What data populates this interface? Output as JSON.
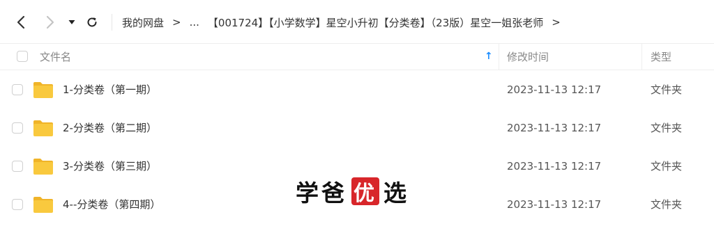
{
  "toolbar": {
    "back_icon": "chevron-left-icon",
    "forward_icon": "chevron-right-icon",
    "dropdown_icon": "caret-down-icon",
    "refresh_icon": "refresh-icon"
  },
  "breadcrumb": {
    "root": "我的网盘",
    "sep1": ">",
    "ellipsis": "...",
    "current": "【001724】【小学数学】星空小升初【分类卷】（23版）星空一姐张老师",
    "sep2": ">"
  },
  "columns": {
    "name": "文件名",
    "sort_indicator": "↑",
    "modified": "修改时间",
    "type": "类型"
  },
  "rows": [
    {
      "name": "1-分类卷（第一期）",
      "modified": "2023-11-13 12:17",
      "type": "文件夹"
    },
    {
      "name": "2-分类卷（第二期）",
      "modified": "2023-11-13 12:17",
      "type": "文件夹"
    },
    {
      "name": "3-分类卷（第三期）",
      "modified": "2023-11-13 12:17",
      "type": "文件夹"
    },
    {
      "name": "4--分类卷（第四期）",
      "modified": "2023-11-13 12:17",
      "type": "文件夹"
    }
  ],
  "watermark": {
    "part1": "学爸",
    "seal": "优",
    "part2": "选"
  },
  "colors": {
    "accent": "#1a8cff",
    "folder": "#f9c93e",
    "folder_tab": "#f0b429",
    "seal": "#d8262a"
  }
}
